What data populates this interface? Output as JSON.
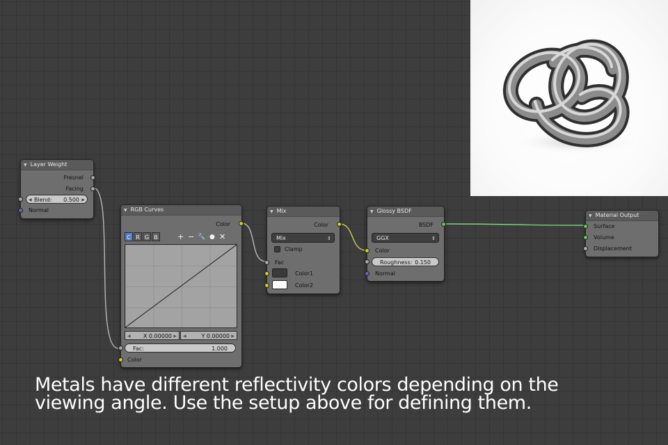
{
  "nodes": {
    "layer_weight": {
      "title": "Layer Weight",
      "outputs": [
        "Fresnel",
        "Facing"
      ],
      "blend_label": "Blend:",
      "blend_value": "0.500",
      "input_normal": "Normal"
    },
    "rgb_curves": {
      "title": "RGB Curves",
      "output_color": "Color",
      "channels": [
        "C",
        "R",
        "G",
        "B"
      ],
      "active_channel": "C",
      "tools": [
        "+",
        "−",
        "🔧",
        "●",
        "✕"
      ],
      "x_field": "X 0.00000",
      "y_field": "Y 0.00000",
      "fac_label": "Fac:",
      "fac_value": "1.000",
      "input_color": "Color"
    },
    "mix": {
      "title": "Mix",
      "output_color": "Color",
      "blend_mode": "Mix",
      "clamp_label": "Clamp",
      "input_fac": "Fac",
      "input_color1": "Color1",
      "input_color2": "Color2",
      "color1_swatch": "#3a3a3a",
      "color2_swatch": "#ffffff"
    },
    "glossy_bsdf": {
      "title": "Glossy BSDF",
      "output_bsdf": "BSDF",
      "distribution": "GGX",
      "input_color": "Color",
      "roughness_label": "Roughness:",
      "roughness_value": "0.150",
      "input_normal": "Normal"
    },
    "material_output": {
      "title": "Material Output",
      "inputs": [
        "Surface",
        "Volume",
        "Displacement"
      ]
    }
  },
  "caption": {
    "line1": "Metals have different reflectivity colors depending on the",
    "line2": "viewing angle. Use the setup above for defining them."
  },
  "colors": {
    "socket_gray": "#a8a8a8",
    "socket_yellow": "#cdcd1f",
    "socket_blue": "#6363c7",
    "socket_green": "#5fc65f",
    "channel_active": "#5680c2"
  }
}
